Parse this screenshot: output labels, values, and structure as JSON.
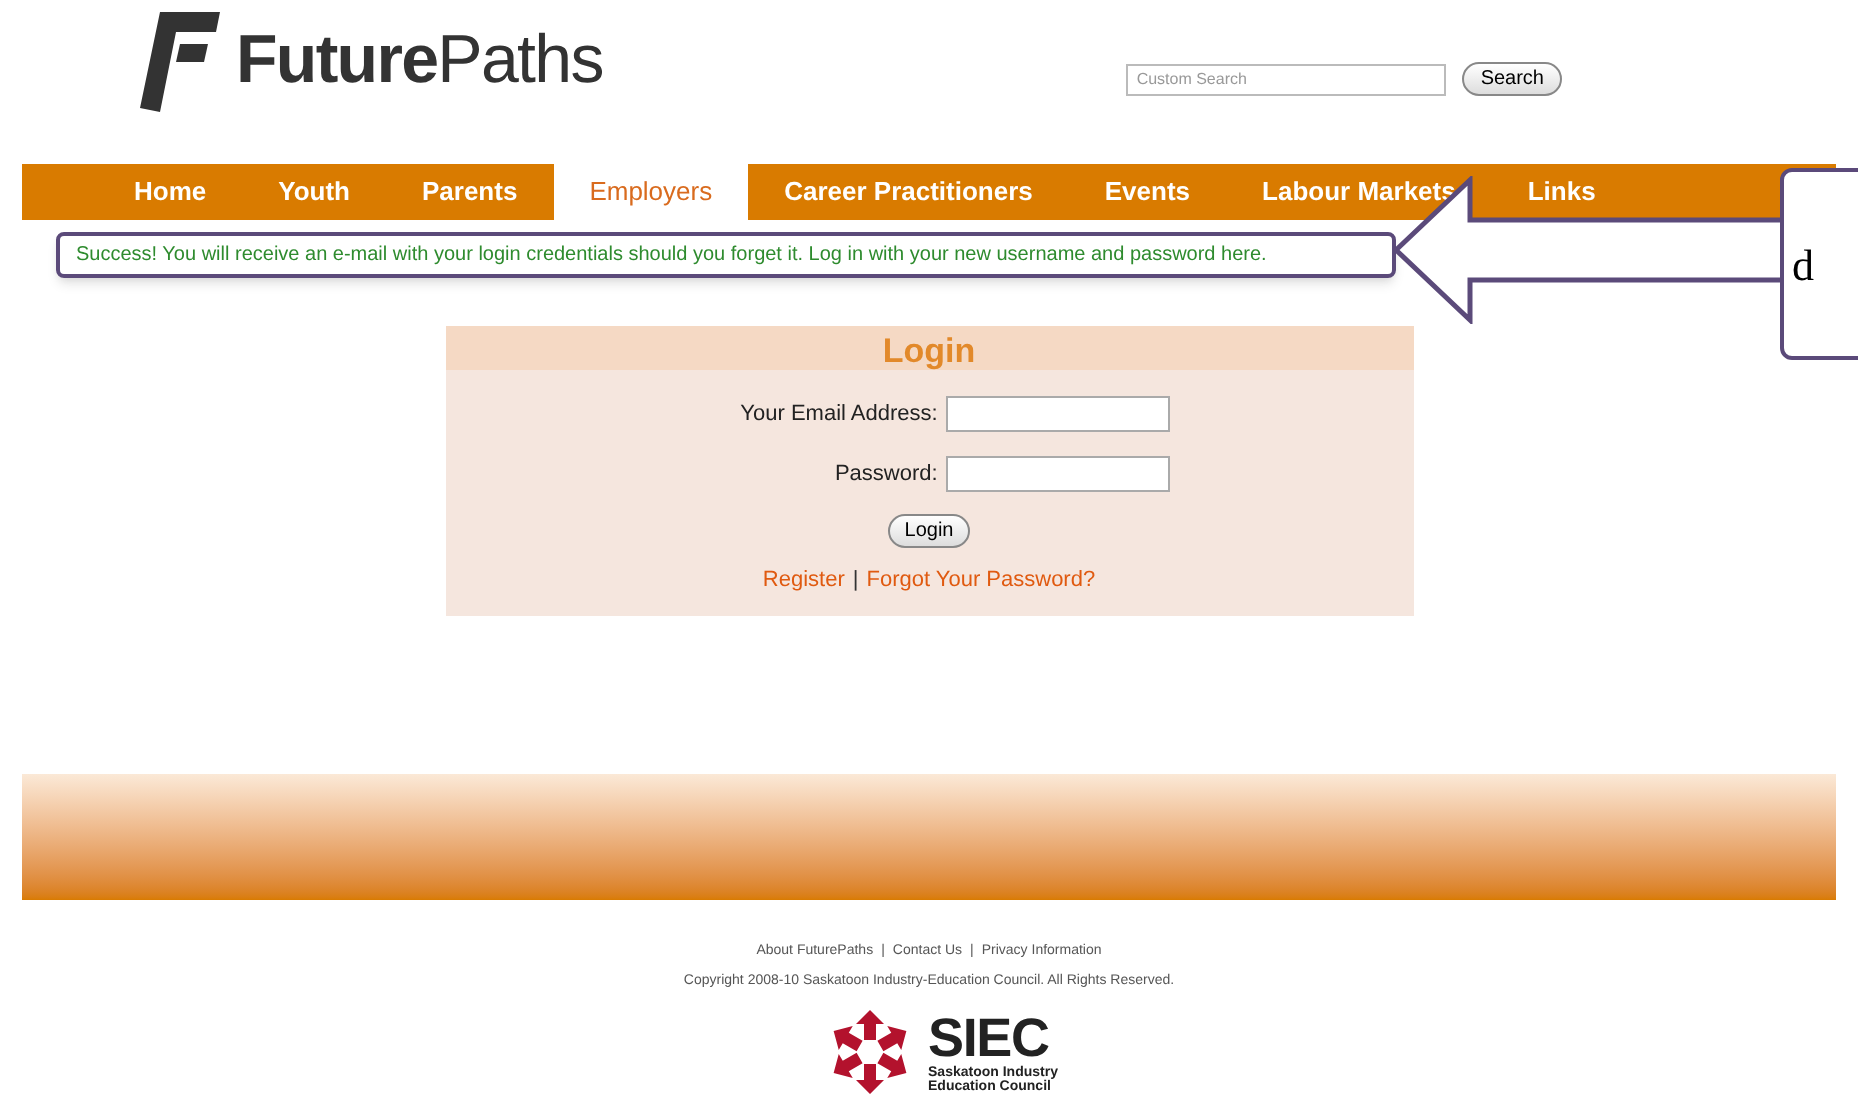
{
  "logo": {
    "text": "**Future**Paths"
  },
  "search": {
    "placeholder": "Custom Search",
    "button": "Search"
  },
  "nav": [
    {
      "label": "Home",
      "selected": false
    },
    {
      "label": "Youth",
      "selected": false
    },
    {
      "label": "Parents",
      "selected": false
    },
    {
      "label": "Employers",
      "selected": true
    },
    {
      "label": "Career Practitioners",
      "selected": false
    },
    {
      "label": "Events",
      "selected": false
    },
    {
      "label": "Labour Markets",
      "selected": false
    },
    {
      "label": "Links",
      "selected": false
    }
  ],
  "message": "Success! You will receive an e-mail with your login credentials should you forget it. Log in with your new username and password here.",
  "login": {
    "title": "Login",
    "fields": [
      {
        "label": "Your Email Address:"
      },
      {
        "label": "Password:"
      }
    ],
    "button": "Login",
    "links": [
      "Register",
      "Forgot Your Password?"
    ],
    "separators": [
      "|"
    ]
  },
  "footer": {
    "links": [
      "About FuturePaths",
      "Contact Us",
      "Privacy Information"
    ],
    "separators": [
      "|",
      "|"
    ],
    "copyright": "Copyright 2008-10 Saskatoon Industry-Education Council. All Rights Reserved.",
    "org_short": "SIEC",
    "org_name": [
      "Saskatoon Industry",
      "Education Council"
    ]
  },
  "callout": {
    "label": "d"
  }
}
